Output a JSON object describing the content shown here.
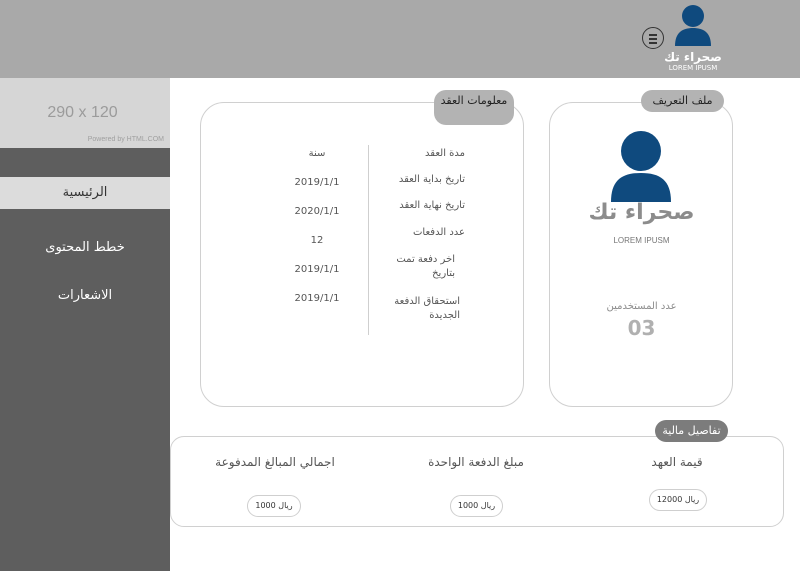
{
  "header": {
    "user_name": "صحراء تك",
    "user_subtitle": "LOREM IPUSM",
    "menu_icon": "menu-circle-icon",
    "avatar_color": "#0f4a7e"
  },
  "sidebar": {
    "banner_size": "290 x 120",
    "banner_powered": "Powered by HTML.COM",
    "items": [
      {
        "label": "الرئيسية",
        "active": true
      },
      {
        "label": "خطط المحتوى",
        "active": false
      },
      {
        "label": "الاشعارات",
        "active": false
      }
    ]
  },
  "contract": {
    "title": "معلومات العقد",
    "rows": [
      {
        "label": "مدة العقد",
        "value": "سنة"
      },
      {
        "label": "تاريخ بداية العقد",
        "value": "2019/1/1"
      },
      {
        "label": "تاريخ نهاية العقد",
        "value": "2020/1/1"
      },
      {
        "label": "عدد الدفعات",
        "value": "12"
      },
      {
        "label": "اخر دفعة تمت بتاريخ",
        "value": "2019/1/1"
      },
      {
        "label": "استحقاق الدفعة الجديدة",
        "value": "2019/1/1"
      }
    ]
  },
  "profile": {
    "title": "ملف التعريف",
    "name": "صحراء تك",
    "subtitle": "LOREM IPUSM",
    "users_label": "عدد المستخدمين",
    "users_count": "03"
  },
  "finance": {
    "title": "تفاصيل مالية",
    "items": [
      {
        "label": "قيمة العهد",
        "value": "12000 ريال"
      },
      {
        "label": "مبلغ الدفعة الواحدة",
        "value": "1000 ريال"
      },
      {
        "label": "اجمالي المبالغ المدفوعة",
        "value": "1000 ريال"
      }
    ]
  }
}
